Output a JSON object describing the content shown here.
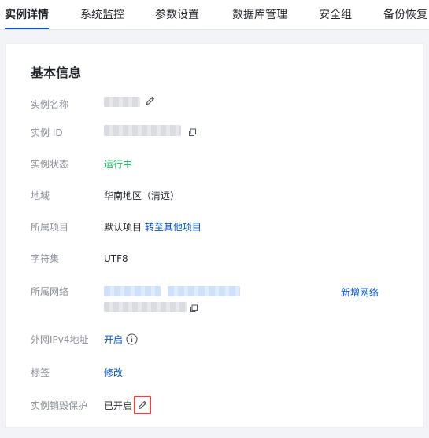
{
  "tabs": [
    {
      "label": "实例详情",
      "active": true
    },
    {
      "label": "系统监控"
    },
    {
      "label": "参数设置"
    },
    {
      "label": "数据库管理"
    },
    {
      "label": "安全组"
    },
    {
      "label": "备份恢复"
    }
  ],
  "section_title": "基本信息",
  "fields": {
    "instance_name": {
      "label": "实例名称"
    },
    "instance_id": {
      "label": "实例 ID"
    },
    "status": {
      "label": "实例状态",
      "value": "运行中"
    },
    "region": {
      "label": "地域",
      "value": "华南地区（清远）"
    },
    "project": {
      "label": "所属项目",
      "value": "默认项目",
      "action": "转至其他项目"
    },
    "charset": {
      "label": "字符集",
      "value": "UTF8"
    },
    "network": {
      "label": "所属网络",
      "action": "新增网络"
    },
    "public_ipv4": {
      "label": "外网IPv4地址",
      "value": "开启"
    },
    "tags": {
      "label": "标签",
      "value": "修改"
    },
    "deletion_protection": {
      "label": "实例销毁保护",
      "value": "已开启"
    }
  },
  "colors": {
    "accent": "#0052d9",
    "success": "#0abf5b",
    "highlight": "#e54545"
  },
  "icons": {
    "edit": "pencil-icon",
    "copy": "copy-icon",
    "info": "info-circle-icon"
  }
}
